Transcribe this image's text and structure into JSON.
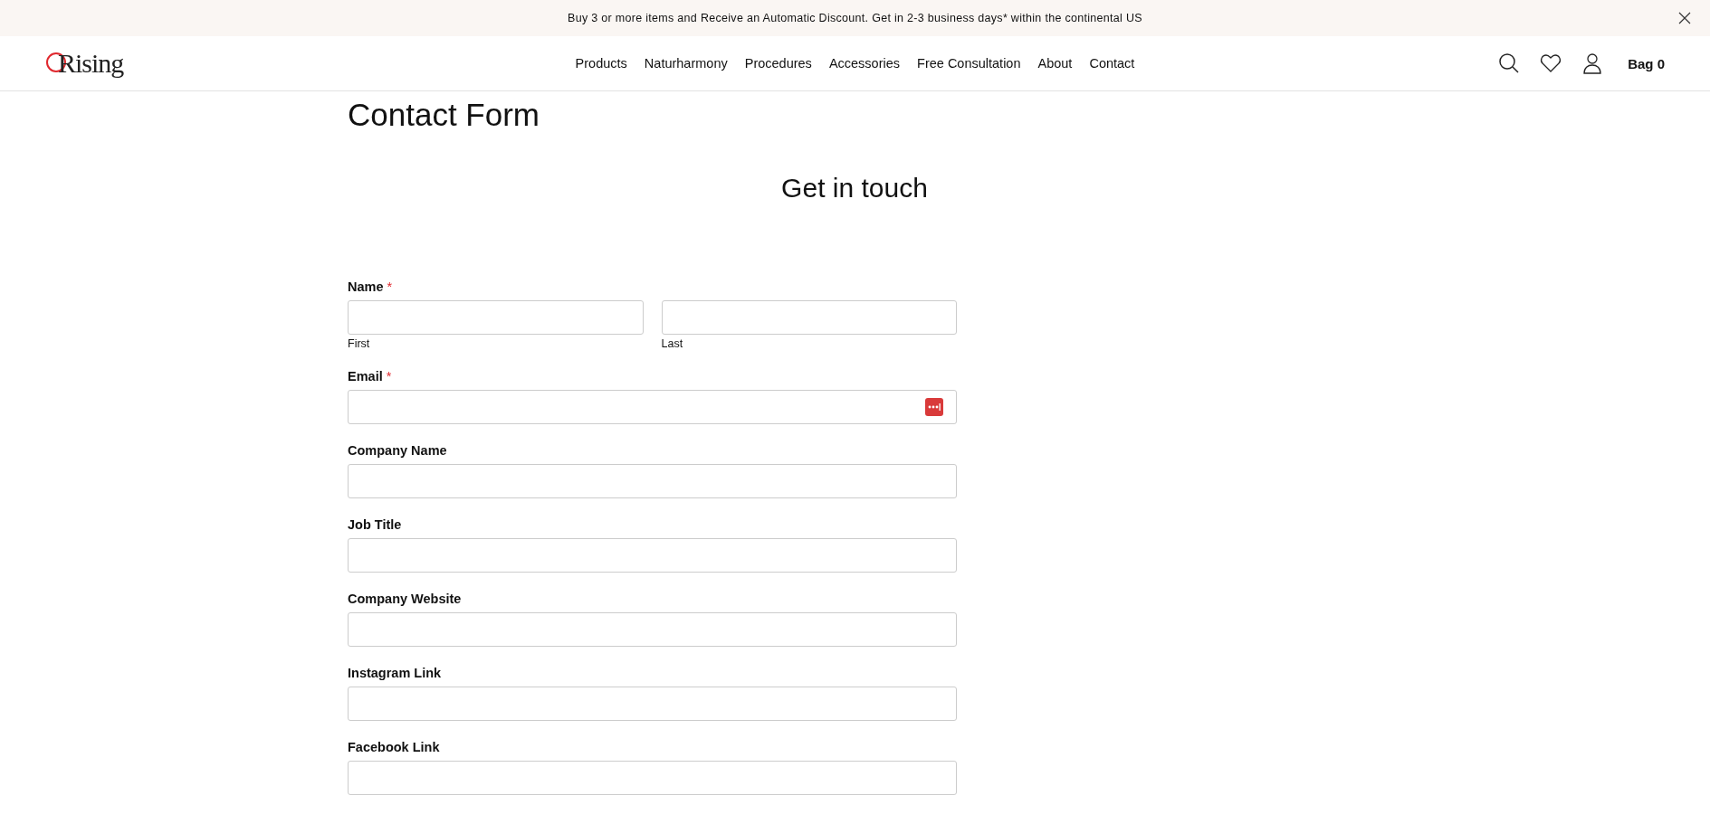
{
  "announcement": {
    "text": "Buy 3 or more items and Receive an Automatic Discount. Get in 2-3 business days* within the continental US"
  },
  "header": {
    "logo": "Rising",
    "nav": [
      "Products",
      "Naturharmony",
      "Procedures",
      "Accessories",
      "Free Consultation",
      "About",
      "Contact"
    ],
    "bag": "Bag 0"
  },
  "page_title": "Contact Form",
  "form": {
    "heading": "Get in touch",
    "fields": [
      {
        "kind": "name",
        "label": "Name",
        "required_mark": "*",
        "sublabels": [
          "First",
          "Last"
        ]
      },
      {
        "kind": "email",
        "label": "Email",
        "required_mark": "*"
      },
      {
        "kind": "text",
        "label": "Company Name"
      },
      {
        "kind": "text",
        "label": "Job Title"
      },
      {
        "kind": "text",
        "label": "Company Website"
      },
      {
        "kind": "text",
        "label": "Instagram Link"
      },
      {
        "kind": "text",
        "label": "Facebook Link"
      }
    ]
  }
}
